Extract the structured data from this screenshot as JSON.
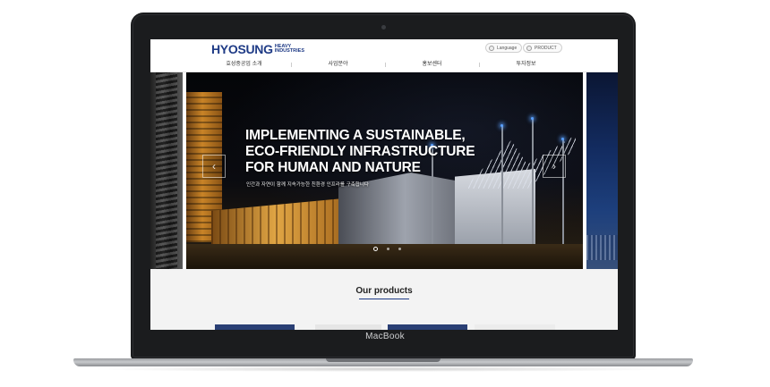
{
  "device": {
    "label": "MacBook"
  },
  "header": {
    "logo_main": "HYOSUNG",
    "logo_sub": "HEAVY INDUSTRIES",
    "language_label": "Language",
    "product_label": "PRODUCT",
    "nav": [
      "효성중공업 소개",
      "사업분야",
      "홍보센터",
      "투자정보"
    ]
  },
  "hero": {
    "headline_line1": "IMPLEMENTING A SUSTAINABLE,",
    "headline_line2": "ECO-FRIENDLY INFRASTRUCTURE",
    "headline_line3": "FOR HUMAN AND NATURE",
    "subtext": "인간과 자연이 함께 지속가능한 친환경 인프라를 구축합니다",
    "prev_icon": "chevron-left-icon",
    "next_icon": "chevron-right-icon",
    "slide_count": 3,
    "active_slide": 1
  },
  "products": {
    "title": "Our products"
  },
  "colors": {
    "brand": "#1f3b86",
    "card_dark": "#2a3f74"
  }
}
